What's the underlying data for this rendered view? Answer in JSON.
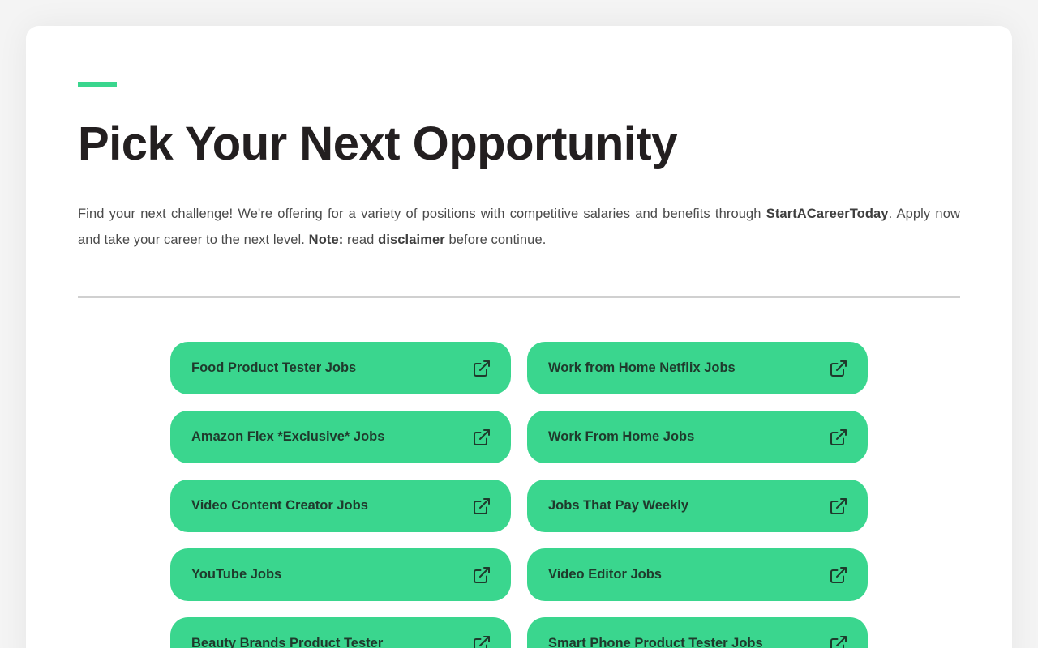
{
  "header": {
    "title": "Pick Your Next Opportunity"
  },
  "intro": {
    "part1": "Find your next challenge! We're offering for a variety of positions with competitive salaries and benefits through ",
    "brand": "StartACareerToday",
    "part2": ". Apply now and take your career to the next level. ",
    "note_label": "Note:",
    "part3": " read ",
    "disclaimer": "disclaimer",
    "part4": " before continue."
  },
  "jobs": [
    {
      "label": "Food Product Tester Jobs",
      "icon": "external-link-icon"
    },
    {
      "label": "Work from Home Netflix Jobs",
      "icon": "external-link-icon"
    },
    {
      "label": "Amazon Flex *Exclusive* Jobs",
      "icon": "external-link-icon"
    },
    {
      "label": "Work From Home Jobs",
      "icon": "external-link-icon"
    },
    {
      "label": "Video Content Creator Jobs",
      "icon": "external-link-icon"
    },
    {
      "label": "Jobs That Pay Weekly",
      "icon": "external-link-icon"
    },
    {
      "label": "YouTube Jobs",
      "icon": "external-link-icon"
    },
    {
      "label": "Video Editor Jobs",
      "icon": "external-link-icon"
    },
    {
      "label": "Beauty Brands Product Tester",
      "icon": "external-link-icon"
    },
    {
      "label": "Smart Phone Product Tester Jobs",
      "icon": "external-link-icon"
    }
  ],
  "colors": {
    "accent": "#3ad68e",
    "title": "#231f20",
    "body_text": "#4a4a4a",
    "button_text": "#1f3a2c"
  }
}
